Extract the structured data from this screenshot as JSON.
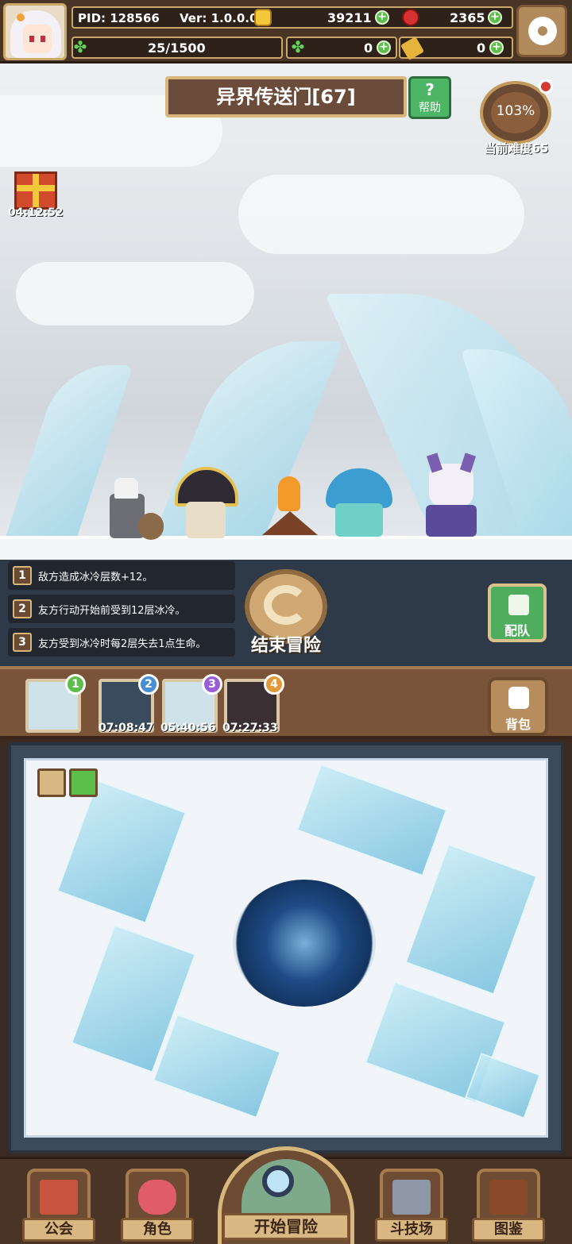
{
  "header": {
    "pid": "PID: 128566",
    "version": "Ver: 1.0.0.0",
    "gold": "39211",
    "gems": "2365",
    "energy": "25/1500",
    "clover": "0",
    "ticket": "0",
    "icons": {
      "gold": "gold-coin-icon",
      "gems": "red-gem-icon",
      "energy": "clover-energy-icon",
      "clover": "four-leaf-clover-icon",
      "ticket": "key-ticket-icon",
      "settings": "gear-icon"
    }
  },
  "stage": {
    "title": "异界传送门[67]",
    "help_label": "帮助",
    "help_symbol": "?",
    "difficulty_percent": "103%",
    "difficulty_label": "当前难度65",
    "gift_timer": "04:12:52"
  },
  "rules": [
    {
      "num": "1",
      "text": "敌方造成冰冷层数+12。"
    },
    {
      "num": "2",
      "text": "友方行动开始前受到12层冰冷。"
    },
    {
      "num": "3",
      "text": "友方受到冰冷时每2层失去1点生命。"
    }
  ],
  "actions": {
    "end_label": "结束冒险",
    "team_label": "配队",
    "bag_label": "背包"
  },
  "slots": [
    {
      "badge": "1",
      "timer": "",
      "color": "#5cbf4a"
    },
    {
      "badge": "2",
      "timer": "07:08:47",
      "color": "#4a8fd6"
    },
    {
      "badge": "3",
      "timer": "05:40:56",
      "color": "#9a5fd6"
    },
    {
      "badge": "4",
      "timer": "07:27:33",
      "color": "#e09a3a"
    }
  ],
  "nav": {
    "guild": "公会",
    "character": "角色",
    "start": "开始冒险",
    "arena": "斗技场",
    "codex": "图鉴"
  },
  "colors": {
    "wood": "#4a3426",
    "gold_trim": "#d9b77c",
    "accent_green": "#4db566"
  }
}
